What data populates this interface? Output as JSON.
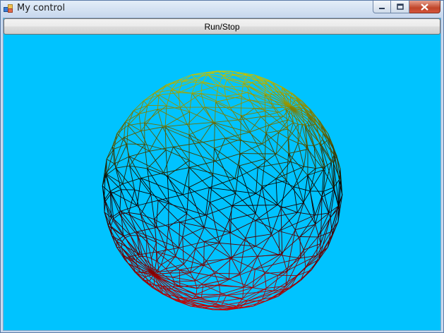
{
  "window": {
    "title": "My control",
    "controls": {
      "minimize_icon": "minimize-icon",
      "maximize_icon": "maximize-icon",
      "close_icon": "close-icon"
    }
  },
  "toolbar": {
    "run_stop_label": "Run/Stop"
  },
  "scene": {
    "background_color": "#00c3ff",
    "object": "wireframe-sphere",
    "gradient_colors": {
      "top": "#c8c800",
      "middle": "#000000",
      "bottom": "#cc0000"
    }
  }
}
